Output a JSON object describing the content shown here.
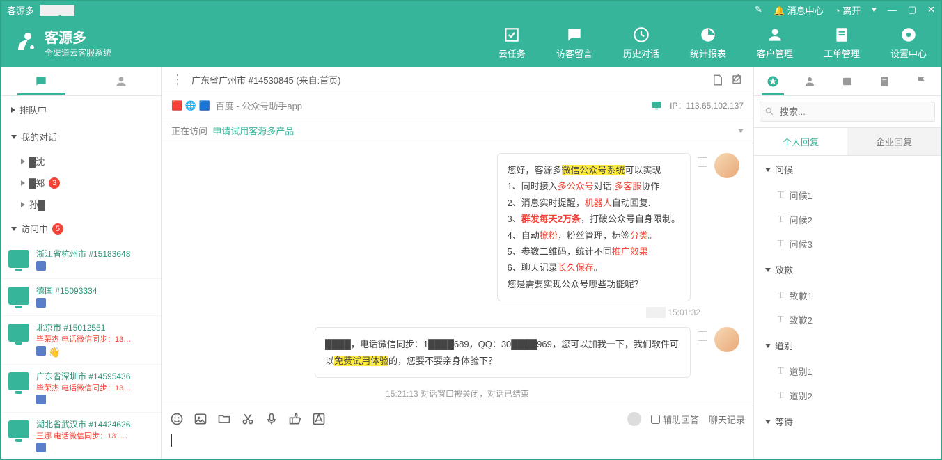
{
  "titlebar": {
    "app": "客源多",
    "msg": "消息中心",
    "leave": "离开"
  },
  "brand": {
    "name": "客源多",
    "sub": "全渠道云客服系统"
  },
  "nav": [
    {
      "k": "cloud-task",
      "l": "云任务"
    },
    {
      "k": "guest-msg",
      "l": "访客留言"
    },
    {
      "k": "history",
      "l": "历史对话"
    },
    {
      "k": "stats",
      "l": "统计报表"
    },
    {
      "k": "customer",
      "l": "客户管理"
    },
    {
      "k": "ticket",
      "l": "工单管理"
    },
    {
      "k": "settings",
      "l": "设置中心"
    }
  ],
  "side": {
    "queue": "排队中",
    "mine": "我的对话",
    "rows": [
      {
        "name": "█沈",
        "badge": ""
      },
      {
        "name": "█郑",
        "badge": "3"
      },
      {
        "name": "孙█",
        "badge": ""
      }
    ],
    "visiting": "访问中",
    "visiting_badge": "5",
    "visitors": [
      {
        "title": "浙江省杭州市 #15183648",
        "sub": "",
        "wave": false
      },
      {
        "title": "德国 #15093334",
        "sub": "",
        "wave": false
      },
      {
        "title": "北京市 #15012551",
        "sub": "毕荣杰 电话微信同步：13…",
        "wave": true
      },
      {
        "title": "广东省深圳市 #14595436",
        "sub": "毕荣杰 电话微信同步：13…",
        "wave": false
      },
      {
        "title": "湖北省武汉市 #14424626",
        "sub": "王娜 电话微信同步：131…",
        "wave": false
      }
    ]
  },
  "chat": {
    "title": "广东省广州市 #14530845 (来自:首页)",
    "source_label": "百度 - 公众号助手app",
    "ip_label": "IP：113.65.102.137",
    "visiting_label": "正在访问",
    "visiting_link": "申请试用客源多产品",
    "msg1": {
      "l0a": "您好，客源多",
      "l0b": "微信公众号系统",
      "l0c": "可以实现",
      "l1a": "1、同时接入",
      "l1b": "多公众号",
      "l1c": "对话,",
      "l1d": "多客服",
      "l1e": "协作.",
      "l2a": "2、消息实时提醒，",
      "l2b": "机器人",
      "l2c": "自动回复.",
      "l3a": "3、",
      "l3b": "群发每天2万条",
      "l3c": "，打破公众号自身限制。",
      "l4a": "4、自动",
      "l4b": "撩粉",
      "l4c": "，粉丝管理，标签",
      "l4d": "分类",
      "l4e": "。",
      "l5a": "5、参数二维码，统计不同",
      "l5b": "推广效果",
      "l6a": "6、聊天记录",
      "l6b": "长久保存",
      "l6c": "。",
      "l7": "您是需要实现公众号哪些功能呢？"
    },
    "time1_pre": "███",
    "time1": "15:01:32",
    "msg2a": "████，电话微信同步：1████689，QQ：30████969，您可以加我一下，我们软件可以",
    "msg2b": "免费试用体验",
    "msg2c": "的，您要不要亲身体验下？",
    "sys": "15:21:13 对话窗口被关闭，对话已结束",
    "assist": "辅助回答",
    "log": "聊天记录"
  },
  "rpanel": {
    "search_ph": "搜索...",
    "tab1": "个人回复",
    "tab2": "企业回复",
    "groups": [
      {
        "name": "问候",
        "items": [
          "问候1",
          "问候2",
          "问候3"
        ]
      },
      {
        "name": "致歉",
        "items": [
          "致歉1",
          "致歉2"
        ]
      },
      {
        "name": "道别",
        "items": [
          "道别1",
          "道别2"
        ]
      },
      {
        "name": "等待",
        "items": []
      }
    ]
  }
}
